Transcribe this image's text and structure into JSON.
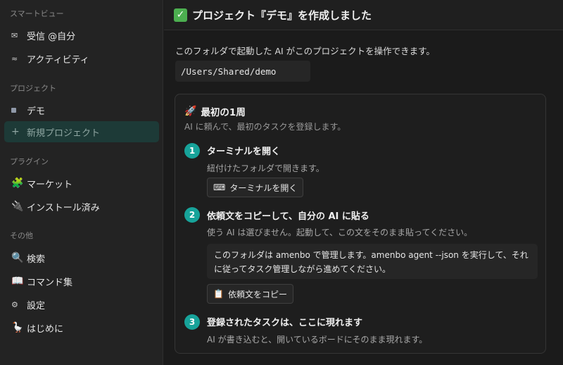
{
  "sidebar": {
    "smart_view_heading": "スマートビュー",
    "smart_view": [
      {
        "icon": "envelope-icon",
        "glyph": "✉",
        "label": "受信 @自分"
      },
      {
        "icon": "activity-icon",
        "glyph": "≈",
        "label": "アクティビティ"
      }
    ],
    "project_heading": "プロジェクト",
    "projects": [
      {
        "icon": "project-square-icon",
        "label": "デモ"
      }
    ],
    "new_project": {
      "glyph": "+",
      "label": "新規プロジェクト"
    },
    "plugin_heading": "プラグイン",
    "plugins": [
      {
        "icon": "puzzle-icon",
        "glyph": "🧩",
        "label": "マーケット"
      },
      {
        "icon": "plug-icon",
        "glyph": "🔌",
        "label": "インストール済み"
      }
    ],
    "other_heading": "その他",
    "other": [
      {
        "icon": "magnifier-icon",
        "glyph": "🔍",
        "label": "検索"
      },
      {
        "icon": "book-icon",
        "glyph": "📖",
        "label": "コマンド集"
      },
      {
        "icon": "gear-icon",
        "glyph": "⚙",
        "label": "設定"
      },
      {
        "icon": "goose-icon",
        "glyph": "🪿",
        "label": "はじめに"
      }
    ]
  },
  "header": {
    "check_glyph": "✓",
    "title": "プロジェクト『デモ』を作成しました"
  },
  "main": {
    "description": "このフォルダで起動した AI がこのプロジェクトを操作できます。",
    "path": "/Users/Shared/demo"
  },
  "card": {
    "title_glyph": "🚀",
    "title": "最初の1周",
    "subtitle": "AI に頼んで、最初のタスクを登録します。",
    "steps": [
      {
        "num": "1",
        "title": "ターミナルを開く",
        "desc": "紐付けたフォルダで開きます。",
        "button_glyph": "⌨",
        "button": "ターミナルを開く"
      },
      {
        "num": "2",
        "title": "依頼文をコピーして、自分の AI に貼る",
        "desc": "使う AI は選びません。起動して、この文をそのまま貼ってください。",
        "quote": "このフォルダは amenbo で管理します。amenbo agent --json を実行して、それに従ってタスク管理しながら進めてください。",
        "button_glyph": "📋",
        "button": "依頼文をコピー"
      },
      {
        "num": "3",
        "title": "登録されたタスクは、ここに現れます",
        "desc": "AI が書き込むと、開いているボードにそのまま現れます。"
      }
    ]
  },
  "colors": {
    "accent": "#17a39a",
    "check": "#4caf50",
    "new_project_bg": "#1d3a37"
  }
}
